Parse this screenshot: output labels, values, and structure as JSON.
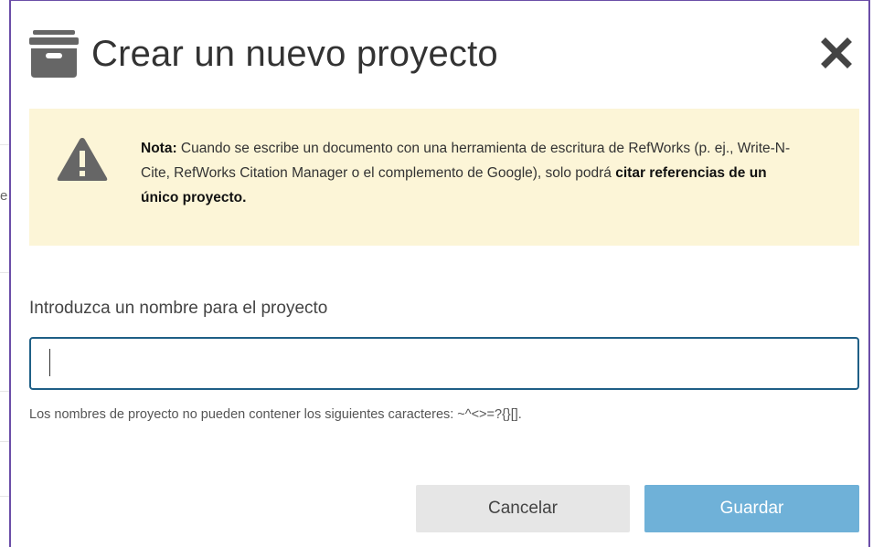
{
  "modal": {
    "title": "Crear un nuevo proyecto",
    "header_icon": "archive-box-icon",
    "close_icon": "close-x-icon"
  },
  "note": {
    "icon": "warning-triangle-icon",
    "label": "Nota:",
    "text": " Cuando se escribe un documento con una herramienta de escritura de RefWorks (p. ej., Write-N-Cite, RefWorks Citation Manager o el complemento de Google), solo podrá ",
    "emphasis": "citar referencias de un único proyecto."
  },
  "form": {
    "name_label": "Introduzca un nombre para el proyecto",
    "name_value": "",
    "help_text": "Los nombres de proyecto no pueden contener los siguientes caracteres: ~^<>=?{}[]."
  },
  "buttons": {
    "cancel_label": "Cancelar",
    "save_label": "Guardar"
  },
  "background": {
    "left_fragment": "e"
  },
  "colors": {
    "modal_border": "#6b4ea8",
    "note_background": "#fcf5d7",
    "input_border": "#1f5f86",
    "save_button": "#6fb1d8",
    "cancel_button": "#e6e6e6"
  }
}
